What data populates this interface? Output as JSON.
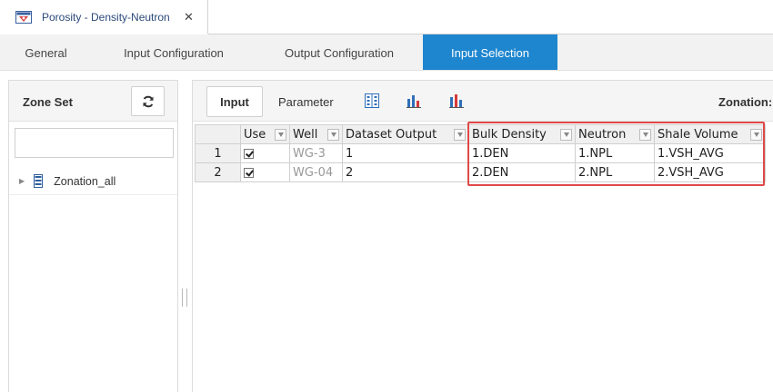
{
  "document_tab": {
    "title": "Porosity - Density-Neutron",
    "close_glyph": "✕",
    "icon": "porosity-app-icon"
  },
  "subtabs": [
    {
      "label": "General",
      "active": false
    },
    {
      "label": "Input Configuration",
      "active": false
    },
    {
      "label": "Output Configuration",
      "active": false
    },
    {
      "label": "Input Selection",
      "active": true
    }
  ],
  "zone_panel": {
    "title": "Zone Set",
    "refresh_icon": "refresh-icon",
    "search": {
      "value": "",
      "placeholder": "",
      "icon": "search-icon"
    },
    "tree": [
      {
        "label": "Zonation_all",
        "icon": "zonation-icon",
        "expanded": false
      }
    ]
  },
  "toolbar": {
    "input_label": "Input",
    "parameter_label": "Parameter",
    "icons": [
      "grid-select-icon",
      "bar-chart-icon",
      "bar-chart-alt-icon"
    ],
    "zonation_label": "Zonation:"
  },
  "grid": {
    "columns": [
      "Use",
      "Well",
      "Dataset Output",
      "Bulk Density",
      "Neutron",
      "Shale Volume"
    ],
    "rows": [
      {
        "num": "1",
        "use": true,
        "well": "WG-3",
        "dataset": "1",
        "density": "1.DEN",
        "neutron": "1.NPL",
        "shale": "1.VSH_AVG"
      },
      {
        "num": "2",
        "use": true,
        "well": "WG-04",
        "dataset": "2",
        "density": "2.DEN",
        "neutron": "2.NPL",
        "shale": "2.VSH_AVG"
      }
    ]
  },
  "colors": {
    "accent": "#1e86cf",
    "highlight": "#e04848",
    "title_text": "#2b4a7a"
  }
}
